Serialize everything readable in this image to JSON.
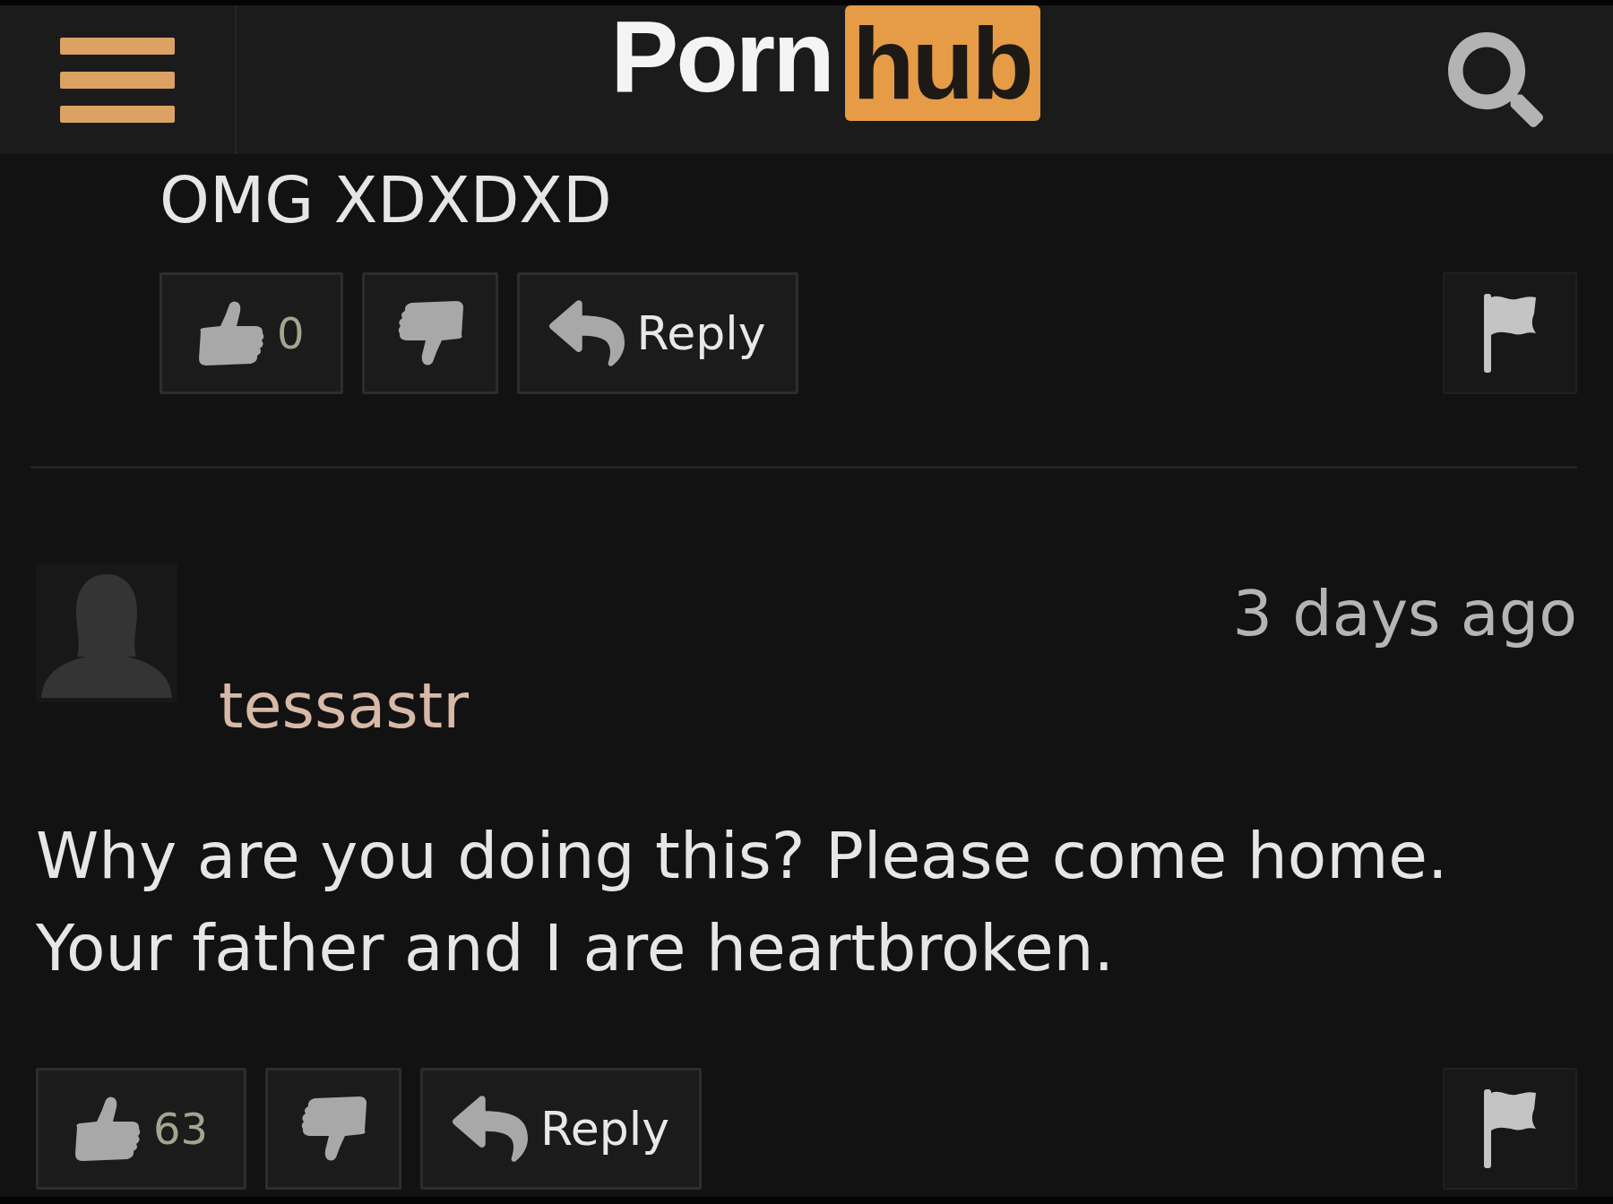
{
  "header": {
    "logo_word": "Porn",
    "logo_badge": "hub"
  },
  "comments": [
    {
      "kind": "reply",
      "text": "OMG XDXDXD",
      "likes": "0",
      "reply_label": "Reply"
    },
    {
      "kind": "comment",
      "username": "tessastr",
      "time": "3 days ago",
      "text": "Why are you doing this? Please come home. Your father and I are heartbroken.",
      "likes": "63",
      "reply_label": "Reply"
    }
  ]
}
